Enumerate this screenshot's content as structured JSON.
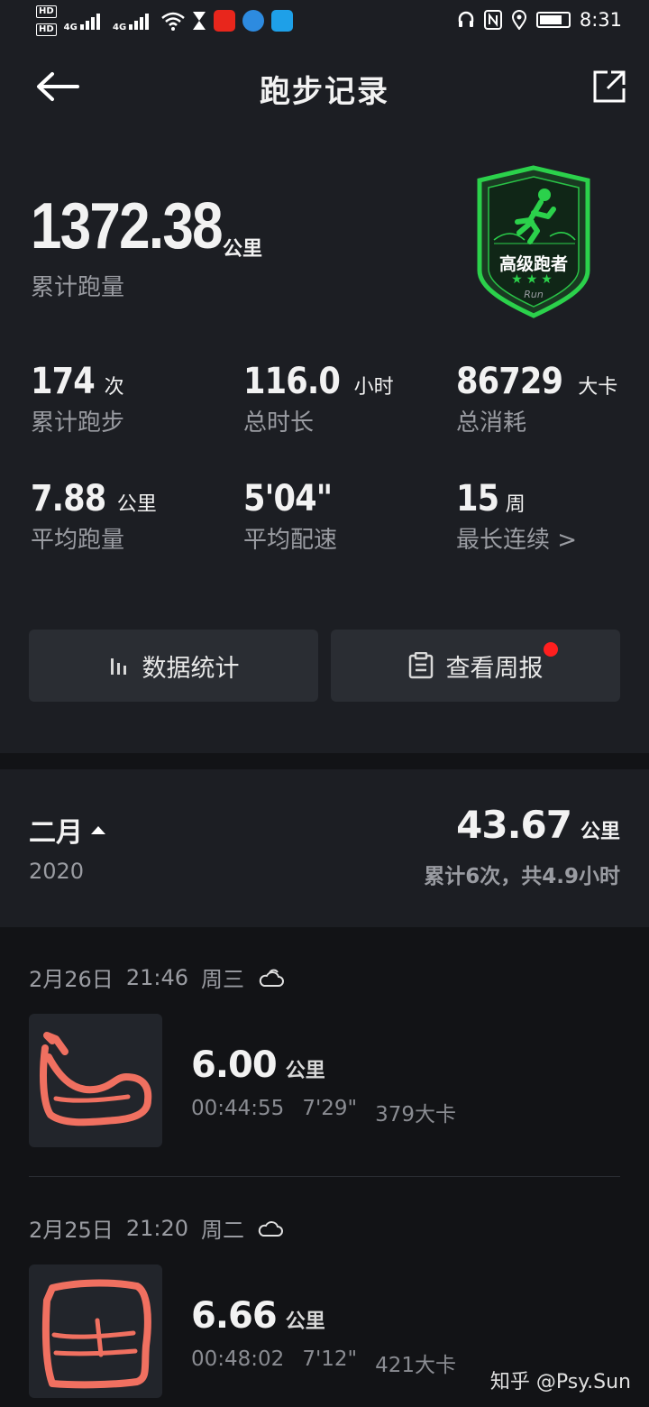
{
  "status_bar": {
    "network": "4G",
    "time": "8:31"
  },
  "header": {
    "title": "跑步记录"
  },
  "summary": {
    "total_distance": "1372.38",
    "total_distance_unit": "公里",
    "total_label": "累计跑量",
    "badge_text": "高级跑者",
    "badge_stars": 3,
    "badge_logo": "Run"
  },
  "stats": [
    {
      "value": "174",
      "unit": "次",
      "label": "累计跑步"
    },
    {
      "value": "116.0",
      "unit": "小时",
      "label": "总时长"
    },
    {
      "value": "86729",
      "unit": "大卡",
      "label": "总消耗"
    },
    {
      "value": "7.88",
      "unit": "公里",
      "label": "平均跑量"
    },
    {
      "value": "5'04\"",
      "unit": "",
      "label": "平均配速"
    },
    {
      "value": "15",
      "unit": "周",
      "label": "最长连续 >"
    }
  ],
  "actions": {
    "stats_label": "数据统计",
    "weekly_label": "查看周报"
  },
  "month": {
    "name": "二月",
    "year": "2020",
    "distance": "43.67",
    "distance_unit": "公里",
    "summary": "累计6次，共4.9小时"
  },
  "runs": [
    {
      "date": "2月26日",
      "time": "21:46",
      "weekday": "周三",
      "weather_icon": "cloud-sun-icon",
      "distance": "6.00",
      "unit": "公里",
      "duration": "00:44:55",
      "pace": "7'29\"",
      "calories": "379大卡"
    },
    {
      "date": "2月25日",
      "time": "21:20",
      "weekday": "周二",
      "weather_icon": "cloud-icon",
      "distance": "6.66",
      "unit": "公里",
      "duration": "00:48:02",
      "pace": "7'12\"",
      "calories": "421大卡"
    }
  ],
  "watermark": "知乎 @Psy.Sun",
  "colors": {
    "background": "#1c1e23",
    "list_background": "#121316",
    "badge_green": "#2bd14b",
    "route_red": "#f07060",
    "notification_red": "#ff1f1f"
  }
}
